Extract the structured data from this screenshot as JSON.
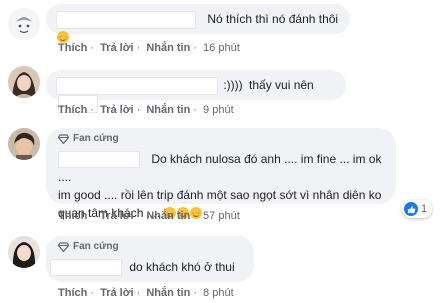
{
  "actions": {
    "like": "Thích",
    "reply": "Trả lời",
    "message": "Nhắn tin"
  },
  "comments": [
    {
      "author": "",
      "text": "Nó thích thì nó đánh thôi",
      "time": "16 phút",
      "avatar": "default-avatar"
    },
    {
      "author": "",
      "text_suffix": ":))))",
      "text": "thấy vui nên",
      "time": "9 phút",
      "avatar": "photo-avatar"
    },
    {
      "badge": "Fan cứng",
      "author": "",
      "text_line1": "Do khách nulosa đó anh .... im fine ... im ok ....",
      "text_line2": "im good .... rồi lên trip đánh một sao ngọt sớt vì nhân diên ko",
      "text_line3": "quan tâm khách ....",
      "time": "57 phút",
      "reaction_count": "1",
      "reaction_type": "like-icon"
    },
    {
      "badge": "Fan cứng",
      "author": "",
      "text": "do khách khó ở thui",
      "time": "8 phút"
    }
  ],
  "colors": {
    "bubble": "#f0f2f5",
    "meta": "#65676b",
    "like": "#1877f2",
    "badge_icon": "#606770"
  }
}
